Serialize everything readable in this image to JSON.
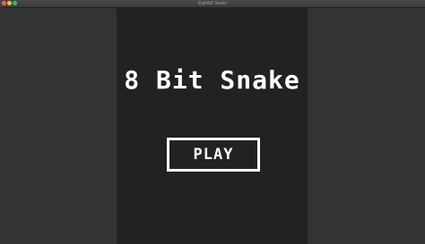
{
  "window": {
    "title": "Eightbit Snake"
  },
  "game": {
    "title": "8 Bit Snake",
    "play_label": "PLAY"
  },
  "colors": {
    "background": "#333333",
    "game_area": "#222222",
    "text": "#ffffff"
  }
}
